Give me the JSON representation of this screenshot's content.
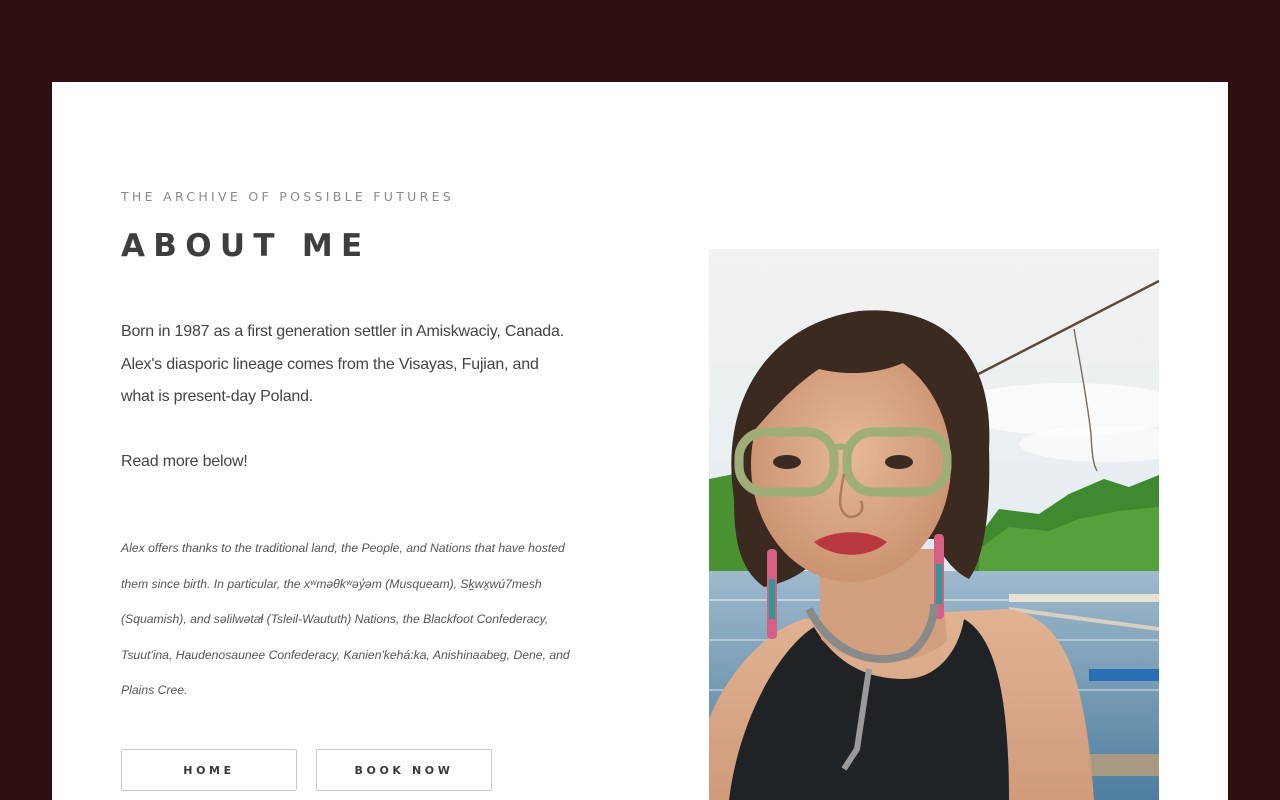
{
  "page": {
    "eyebrow": "THE ARCHIVE OF POSSIBLE FUTURES",
    "title": "ABOUT ME",
    "bio": "Born in 1987 as a first generation settler in Amiskwaciy, Canada. Alex's diasporic lineage comes from the Visayas, Fujian, and what is present-day Poland.",
    "read_more": "Read more below!",
    "acknowledgement": "Alex offers thanks to the traditional land, the People, and Nations that have hosted them since birth. In particular, the xʷməθkʷəy̓əm (Musqueam), Sḵwx̱wú7mesh (Squamish), and səlilwətaɬ (Tsleil-Waututh) Nations, the Blackfoot Confederacy, Tsuut'ina, Haudenosaunee Confederacy, Kanien'kehá:ka, Anishinaabeg, Dene, and Plains Cree."
  },
  "buttons": {
    "home": "HOME",
    "book_now": "BOOK NOW"
  },
  "photo": {
    "subject": "portrait photo"
  },
  "colors": {
    "background": "#2e0e0e",
    "card": "#ffffff",
    "heading": "#3e3e3e",
    "body_text": "#444444"
  }
}
